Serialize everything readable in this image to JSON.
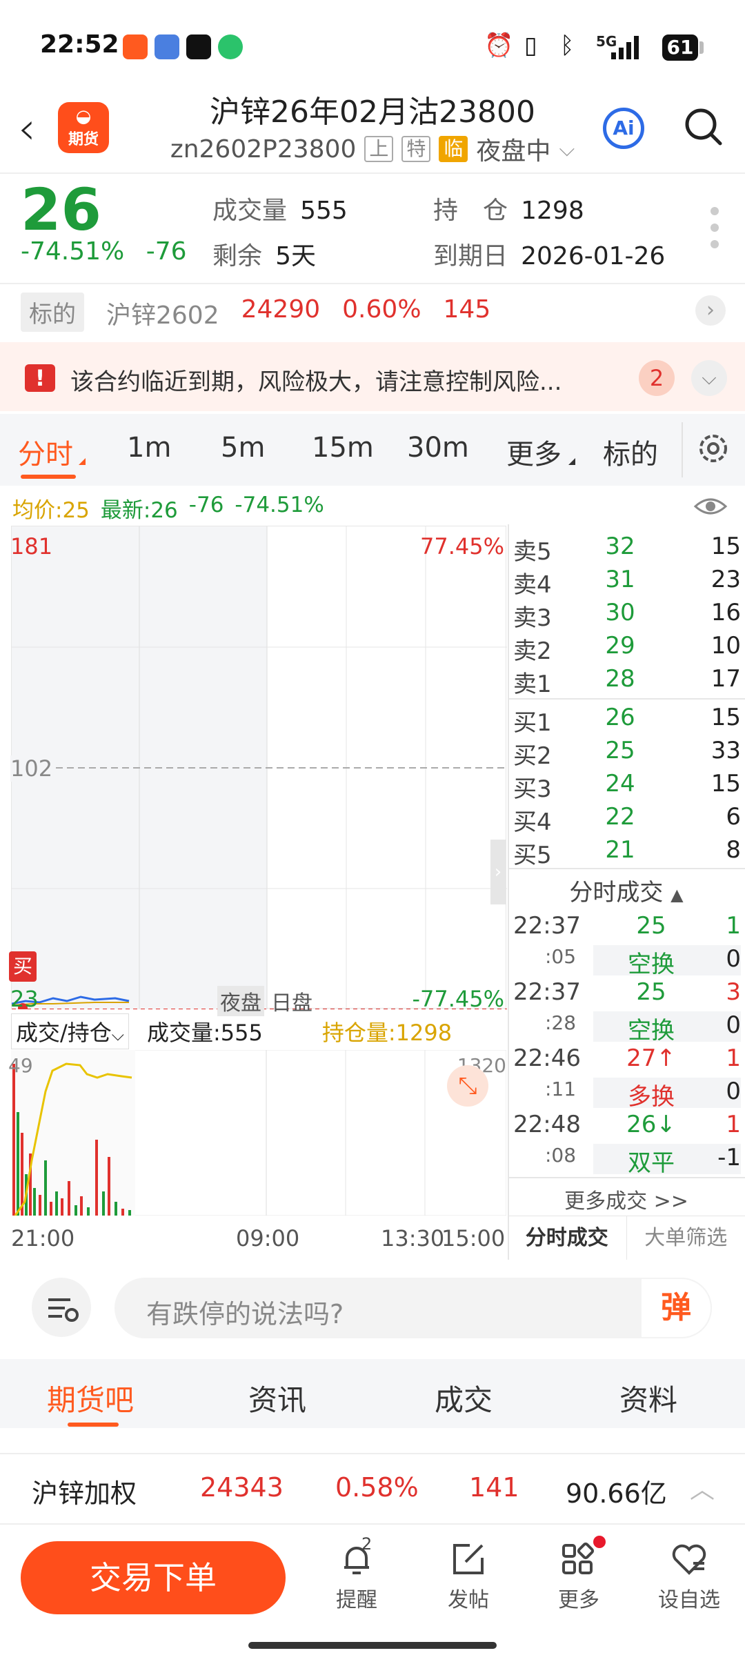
{
  "status_bar": {
    "time": "22:52",
    "battery": "61",
    "network": "5G"
  },
  "header": {
    "logo_text": "期货",
    "title": "沪锌26年02月沽23800",
    "code": "zn2602P23800",
    "tags": [
      "上",
      "特",
      "临"
    ],
    "session": "夜盘中",
    "ai_label": "Ai"
  },
  "quote": {
    "price": "26",
    "change_pct": "-74.51%",
    "change": "-76",
    "volume_label": "成交量",
    "volume": "555",
    "remaining_label": "剩余",
    "remaining": "5天",
    "position_label": "持　仓",
    "position": "1298",
    "expiry_label": "到期日",
    "expiry": "2026-01-26"
  },
  "underlying": {
    "tag": "标的",
    "name": "沪锌2602",
    "price": "24290",
    "pct": "0.60%",
    "change": "145"
  },
  "warning": {
    "icon": "!",
    "text": "该合约临近到期，风险极大，请注意控制风险...",
    "count": "2"
  },
  "tabs": [
    "分时",
    "1m",
    "5m",
    "15m",
    "30m",
    "更多",
    "标的"
  ],
  "info_line": {
    "avg": "均价:25",
    "latest": "最新:26",
    "chg": "-76",
    "pct": "-74.51%"
  },
  "chart": {
    "y_top": "181",
    "y_mid": "102",
    "y_bottom": "23",
    "pct_top": "77.45%",
    "pct_bottom": "-77.45%",
    "buy_marker": "买",
    "night_label": "夜盘",
    "day_label": "日盘"
  },
  "volume_header": {
    "selector": "成交/持仓",
    "volume": "成交量:555",
    "position": "持仓量:1298"
  },
  "volume_chart": {
    "y_top": "49",
    "pos_top": "1320"
  },
  "time_axis": [
    "21:00",
    "09:00",
    "13:30",
    "15:00"
  ],
  "order_book": {
    "asks": [
      {
        "label": "卖5",
        "price": "32",
        "vol": "15"
      },
      {
        "label": "卖4",
        "price": "31",
        "vol": "23"
      },
      {
        "label": "卖3",
        "price": "30",
        "vol": "16"
      },
      {
        "label": "卖2",
        "price": "29",
        "vol": "10"
      },
      {
        "label": "卖1",
        "price": "28",
        "vol": "17"
      }
    ],
    "bids": [
      {
        "label": "买1",
        "price": "26",
        "vol": "15"
      },
      {
        "label": "买2",
        "price": "25",
        "vol": "33"
      },
      {
        "label": "买3",
        "price": "24",
        "vol": "15"
      },
      {
        "label": "买4",
        "price": "22",
        "vol": "6"
      },
      {
        "label": "买5",
        "price": "21",
        "vol": "8"
      }
    ]
  },
  "ticks": {
    "title": "分时成交",
    "rows": [
      {
        "time": "22:37",
        "sec": ":05",
        "price": "25",
        "arrow": "",
        "vol": "1",
        "type": "空换",
        "oi": "0"
      },
      {
        "time": "22:37",
        "sec": ":28",
        "price": "25",
        "arrow": "",
        "vol": "3",
        "type": "空换",
        "oi": "0"
      },
      {
        "time": "22:46",
        "sec": ":11",
        "price": "27",
        "arrow": "↑",
        "vol": "1",
        "type": "多换",
        "oi": "0"
      },
      {
        "time": "22:48",
        "sec": ":08",
        "price": "26",
        "arrow": "↓",
        "vol": "1",
        "type": "双平",
        "oi": "-1"
      }
    ],
    "more": "更多成交 >>",
    "tab_active": "分时成交",
    "tab_other": "大单筛选"
  },
  "comment": {
    "placeholder": "有跌停的说法吗?",
    "danmu": "弹"
  },
  "bottom_tabs": [
    "期货吧",
    "资讯",
    "成交",
    "资料"
  ],
  "index_bar": {
    "name": "沪锌加权",
    "price": "24343",
    "pct": "0.58%",
    "change": "141",
    "amount": "90.66亿"
  },
  "bottom_nav": {
    "trade": "交易下单",
    "items": [
      "提醒",
      "发帖",
      "更多",
      "设自选"
    ],
    "reminder_badge": "2"
  }
}
